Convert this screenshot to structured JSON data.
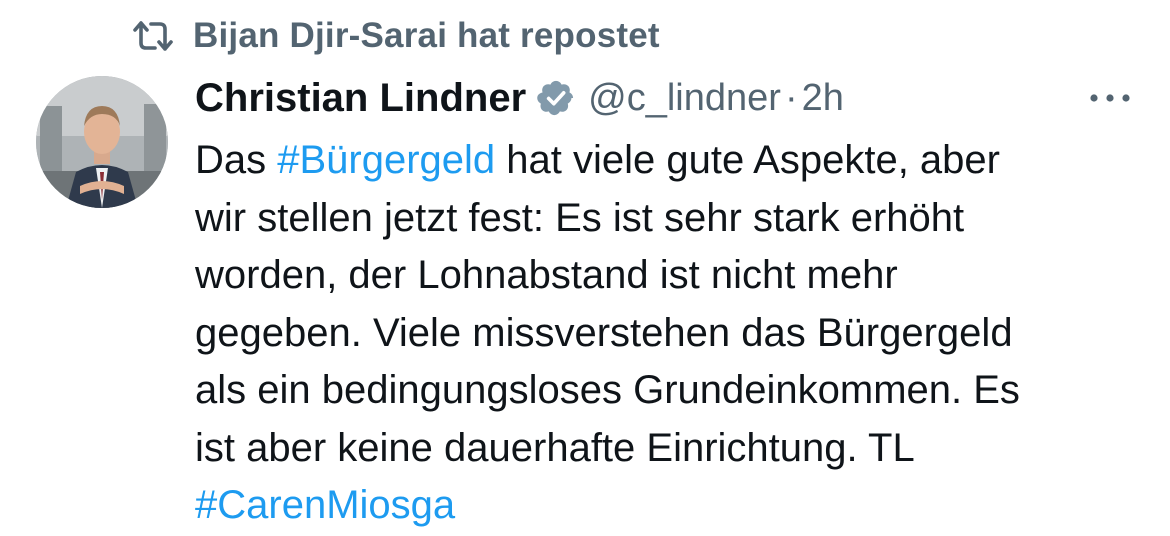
{
  "repost": {
    "text": "Bijan Djir-Sarai hat repostet",
    "icon": "repost-icon"
  },
  "author": {
    "name": "Christian Lindner",
    "handle": "@c_lindner",
    "separator": "·",
    "time": "2h",
    "verified": true,
    "avatar_icon": "avatar"
  },
  "tweet": {
    "lines": [
      [
        {
          "t": "Das "
        },
        {
          "t": "#Bürgergeld",
          "tag": true
        },
        {
          "t": " hat viele gute Aspekte, aber"
        }
      ],
      [
        {
          "t": "wir stellen jetzt fest: Es ist sehr stark erhöht"
        }
      ],
      [
        {
          "t": "worden, der Lohnabstand ist nicht mehr"
        }
      ],
      [
        {
          "t": "gegeben. Viele missverstehen das Bürgergeld"
        }
      ],
      [
        {
          "t": "als ein bedingungsloses Grundeinkommen. Es"
        }
      ],
      [
        {
          "t": "ist aber keine dauerhafte Einrichtung. TL"
        }
      ],
      [
        {
          "t": "#CarenMiosga",
          "tag": true
        }
      ]
    ]
  },
  "colors": {
    "text": "#0f1419",
    "secondary": "#536471",
    "hashtag": "#1d9bf0",
    "verified": "#829aab"
  }
}
